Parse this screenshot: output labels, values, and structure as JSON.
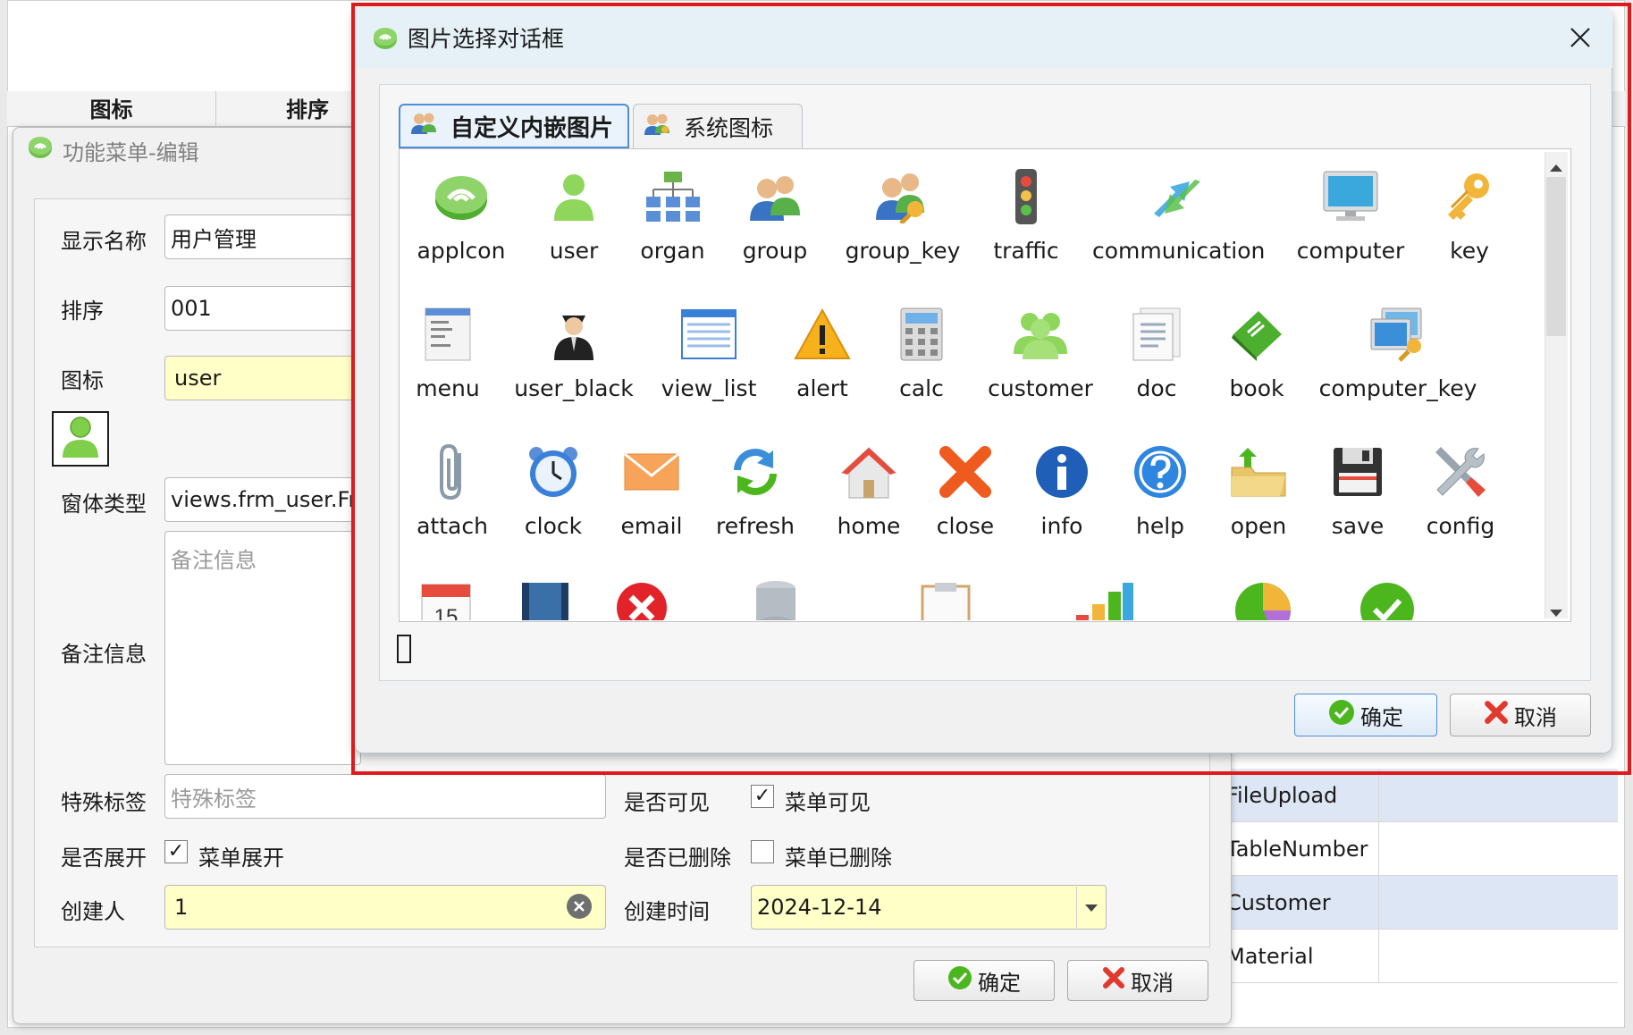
{
  "background_grid": {
    "columns": [
      "图标",
      "排序"
    ],
    "rows": [
      {
        "text": "FileUpload",
        "selected": true
      },
      {
        "text": "TableNumber",
        "selected": false
      },
      {
        "text": "Customer",
        "selected": true
      },
      {
        "text": "Material",
        "selected": false
      }
    ]
  },
  "editor": {
    "title": "功能菜单-编辑",
    "fields": {
      "display_name": {
        "label": "显示名称",
        "value": "用户管理"
      },
      "order": {
        "label": "排序",
        "value": "001"
      },
      "icon": {
        "label": "图标",
        "value": "user"
      },
      "form_type": {
        "label": "窗体类型",
        "value": "views.frm_user.Frm"
      },
      "remark": {
        "label": "备注信息",
        "placeholder": "备注信息"
      },
      "special_tag": {
        "label": "特殊标签",
        "placeholder": "特殊标签"
      },
      "visible": {
        "label": "是否可见",
        "checkbox_label": "菜单可见",
        "checked": true
      },
      "expanded": {
        "label": "是否展开",
        "checkbox_label": "菜单展开",
        "checked": true
      },
      "deleted": {
        "label": "是否已删除",
        "checkbox_label": "菜单已删除",
        "checked": false
      },
      "creator": {
        "label": "创建人",
        "value": "1"
      },
      "created_time": {
        "label": "创建时间",
        "value": "2024-12-14"
      }
    },
    "ok_label": "确定",
    "cancel_label": "取消",
    "check_mark": "✓"
  },
  "image_dialog": {
    "title": "图片选择对话框",
    "tabs": [
      {
        "label": "自定义内嵌图片",
        "active": true
      },
      {
        "label": "系统图标",
        "active": false
      }
    ],
    "rows": [
      [
        "applcon",
        "user",
        "organ",
        "group",
        "group_key",
        "traffic",
        "communication",
        "computer",
        "key"
      ],
      [
        "menu",
        "user_black",
        "view_list",
        "alert",
        "calc",
        "customer",
        "doc",
        "book",
        "computer_key"
      ],
      [
        "attach",
        "clock",
        "email",
        "refresh",
        "home",
        "close",
        "info",
        "help",
        "open",
        "save",
        "config"
      ]
    ],
    "ok_label": "确定",
    "cancel_label": "取消"
  },
  "colors": {
    "highlight_frame": "#e01a1a",
    "input_yellow": "#ffffc8",
    "selection_blue": "#dde6f4",
    "ok_green": "#4cb61e",
    "cancel_red": "#e03a2e"
  }
}
